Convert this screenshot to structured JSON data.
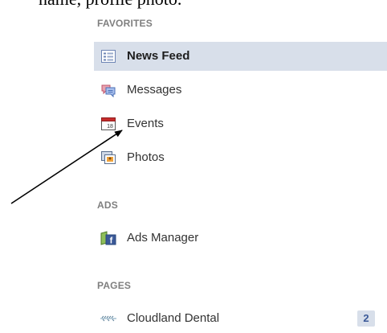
{
  "caption": "name, profile photo.",
  "sections": {
    "favorites": {
      "title": "FAVORITES",
      "items": [
        {
          "label": "News Feed",
          "icon": "news-feed-icon",
          "selected": true
        },
        {
          "label": "Messages",
          "icon": "messages-icon"
        },
        {
          "label": "Events",
          "icon": "events-icon"
        },
        {
          "label": "Photos",
          "icon": "photos-icon"
        }
      ]
    },
    "ads": {
      "title": "ADS",
      "items": [
        {
          "label": "Ads Manager",
          "icon": "ads-manager-icon"
        }
      ]
    },
    "pages": {
      "title": "PAGES",
      "items": [
        {
          "label": "Cloudland Dental",
          "icon": "page-logo-icon",
          "count": "2"
        }
      ]
    }
  },
  "colors": {
    "selected_bg": "#d8dfea",
    "section_title": "#7f7f7f",
    "facebook_blue": "#3b5998"
  }
}
